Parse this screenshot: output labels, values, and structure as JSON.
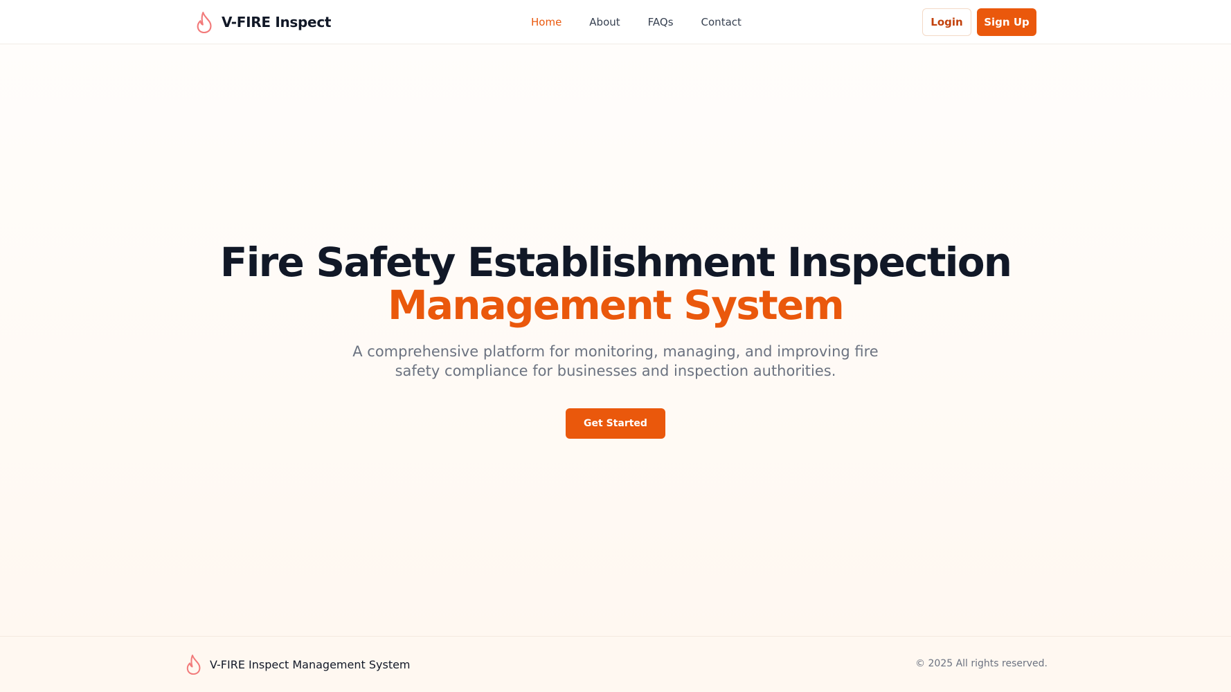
{
  "colors": {
    "accent": "#ea580c",
    "flame_icon": "#f27a7a",
    "heading": "#111827",
    "muted_text": "#6b7280",
    "background": "#fffdfb"
  },
  "header": {
    "brand_icon": "flame-icon",
    "brand_name": "V-FIRE Inspect",
    "nav": [
      {
        "label": "Home",
        "active": true
      },
      {
        "label": "About",
        "active": false
      },
      {
        "label": "FAQs",
        "active": false
      },
      {
        "label": "Contact",
        "active": false
      }
    ],
    "login_label": "Login",
    "signup_label": "Sign Up"
  },
  "hero": {
    "title_line1": "Fire Safety Establishment Inspection",
    "title_line2": "Management System",
    "subtitle": "A comprehensive platform for monitoring, managing, and improving fire safety compliance for businesses and inspection authorities.",
    "cta_label": "Get Started"
  },
  "footer": {
    "brand_icon": "flame-icon",
    "brand_name": "V-FIRE Inspect Management System",
    "copyright": "© 2025 All rights reserved."
  }
}
